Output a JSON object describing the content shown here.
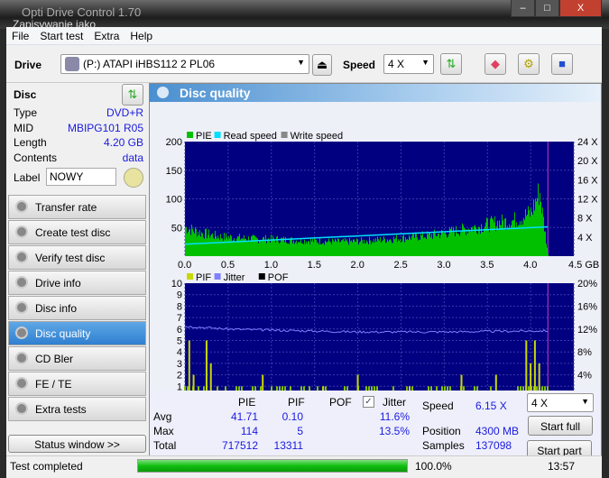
{
  "window": {
    "title": "Opti Drive Control 1.70",
    "overlay_title": "Zapisywanie jako",
    "minimize": "–",
    "maximize": "□",
    "close": "X"
  },
  "menu": [
    "File",
    "Start test",
    "Extra",
    "Help"
  ],
  "toolbar": {
    "drive_label": "Drive",
    "drive_value": "(P:)  ATAPI iHBS112   2 PL06",
    "speed_label": "Speed",
    "speed_value": "4 X"
  },
  "disc": {
    "header": "Disc",
    "props": [
      {
        "k": "Type",
        "v": "DVD+R"
      },
      {
        "k": "MID",
        "v": "MBIPG101 R05"
      },
      {
        "k": "Length",
        "v": "4.20 GB"
      },
      {
        "k": "Contents",
        "v": "data"
      }
    ],
    "label_key": "Label",
    "label_value": "NOWY"
  },
  "nav": [
    {
      "label": "Transfer rate"
    },
    {
      "label": "Create test disc"
    },
    {
      "label": "Verify test disc"
    },
    {
      "label": "Drive info"
    },
    {
      "label": "Disc info"
    },
    {
      "label": "Disc quality",
      "active": true
    },
    {
      "label": "CD Bler"
    },
    {
      "label": "FE / TE"
    },
    {
      "label": "Extra tests"
    }
  ],
  "status_window": "Status window >>",
  "panel_title": "Disc quality",
  "colors": {
    "pie": "#00c000",
    "pif": "#c8d800",
    "read_speed": "#00e0ff",
    "jitter": "#8080ff",
    "plot_bg": "#000080",
    "accent": "#2f7fd0"
  },
  "chart_data": [
    {
      "type": "area",
      "legend": [
        "PIE",
        "Read speed",
        "Write speed"
      ],
      "x_unit": "GB",
      "xlim": [
        0,
        4.5
      ],
      "xticks": [
        "0.0",
        "0.5",
        "1.0",
        "1.5",
        "2.0",
        "2.5",
        "3.0",
        "3.5",
        "4.0",
        "4.5 GB"
      ],
      "ylim": [
        0,
        200
      ],
      "yticks": [
        "200",
        "150",
        "100",
        "50"
      ],
      "y2lim": [
        0,
        24
      ],
      "y2ticks": [
        "24 X",
        "20 X",
        "16 X",
        "12 X",
        "8 X",
        "4 X"
      ],
      "pie_x": [
        0,
        0.2,
        0.4,
        0.6,
        0.8,
        1.0,
        1.2,
        1.4,
        1.6,
        1.8,
        2.0,
        2.2,
        2.4,
        2.6,
        2.8,
        3.0,
        3.2,
        3.4,
        3.6,
        3.8,
        4.0,
        4.1,
        4.2
      ],
      "pie_y": [
        50,
        40,
        34,
        32,
        30,
        30,
        28,
        27,
        26,
        25,
        26,
        28,
        30,
        33,
        36,
        40,
        46,
        52,
        58,
        62,
        75,
        114,
        0
      ],
      "read_speed_x": [
        0,
        4.2
      ],
      "read_speed_y": [
        2.5,
        6.15
      ]
    },
    {
      "type": "bar",
      "legend": [
        "PIF",
        "Jitter",
        "POF"
      ],
      "xlim": [
        0,
        4.5
      ],
      "xticks": [
        "0.0",
        "0.5",
        "1.0",
        "1.5",
        "2.0",
        "2.5",
        "3.0",
        "3.5",
        "4.0",
        "4.5 GB"
      ],
      "ylim": [
        0,
        10
      ],
      "yticks": [
        "10",
        "9",
        "8",
        "7",
        "6",
        "5",
        "4",
        "3",
        "2",
        "1"
      ],
      "y2lim": [
        0,
        20
      ],
      "y2ticks": [
        "20%",
        "16%",
        "12%",
        "8%",
        "4%"
      ],
      "pif_x": [
        0.05,
        0.1,
        0.25,
        0.3,
        0.9,
        1.6,
        2.0,
        2.6,
        3.2,
        3.6,
        3.95,
        4.0,
        4.05,
        4.1
      ],
      "pif_y": [
        5,
        2,
        5,
        3,
        2,
        1,
        2,
        1,
        2,
        2,
        5,
        3,
        5,
        3
      ],
      "jitter_x": [
        0,
        0.5,
        1.0,
        2.0,
        3.0,
        4.2
      ],
      "jitter_y": [
        12.5,
        12.0,
        11.8,
        11.5,
        11.5,
        11.7
      ]
    }
  ],
  "stats": {
    "headers": [
      "PIE",
      "PIF",
      "POF",
      "Jitter"
    ],
    "jitter_checked": true,
    "rows": [
      {
        "k": "Avg",
        "pie": "41.71",
        "pif": "0.10",
        "jit": "11.6%"
      },
      {
        "k": "Max",
        "pie": "114",
        "pif": "5",
        "jit": "13.5%"
      },
      {
        "k": "Total",
        "pie": "717512",
        "pif": "13311",
        "jit": ""
      }
    ],
    "speed_label": "Speed",
    "speed_value": "6.15 X",
    "position_label": "Position",
    "position_value": "4300 MB",
    "samples_label": "Samples",
    "samples_value": "137098",
    "speed_select": "4 X",
    "start_full": "Start full",
    "start_part": "Start part"
  },
  "status": {
    "text": "Test completed",
    "progress": 100,
    "progress_text": "100.0%",
    "time": "13:57"
  }
}
